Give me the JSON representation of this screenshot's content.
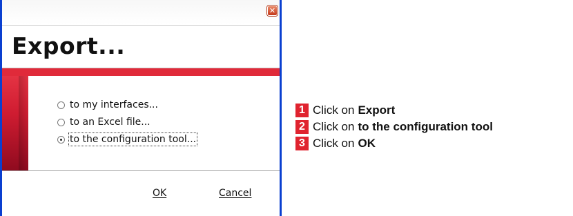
{
  "dialog": {
    "close_glyph": "✕",
    "title": "Export...",
    "options": [
      {
        "label": "to my interfaces...",
        "selected": false
      },
      {
        "label": "to an Excel file...",
        "selected": false
      },
      {
        "label": "to the configuration tool...",
        "selected": true
      }
    ],
    "ok_label": "OK",
    "cancel_label": "Cancel"
  },
  "colors": {
    "accent_red": "#e0232f",
    "window_border": "#0a3fd0"
  },
  "instructions": {
    "steps": [
      {
        "number": "1",
        "prefix": "Click on",
        "target": "Export"
      },
      {
        "number": "2",
        "prefix": "Click on",
        "target": "to the configuration tool"
      },
      {
        "number": "3",
        "prefix": "Click on",
        "target": "OK"
      }
    ]
  }
}
